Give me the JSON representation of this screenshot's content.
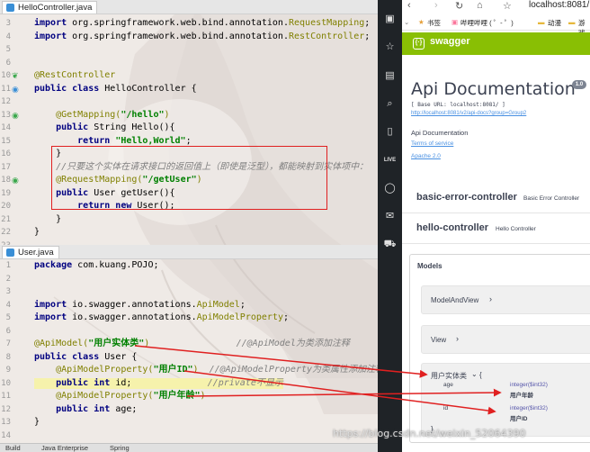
{
  "ide": {
    "tab1": {
      "label": "HelloController.java"
    },
    "tab2": {
      "label": "User.java"
    },
    "file1": {
      "lines": [
        {
          "num": "3",
          "tokens": [
            [
              "kw",
              "import "
            ],
            [
              "pl",
              "org.springframework.web.bind.annotation."
            ],
            [
              "an",
              "RequestMapping"
            ],
            [
              "pl",
              ";"
            ]
          ]
        },
        {
          "num": "4",
          "tokens": [
            [
              "kw",
              "import "
            ],
            [
              "pl",
              "org.springframework.web.bind.annotation."
            ],
            [
              "an",
              "RestController"
            ],
            [
              "pl",
              ";"
            ]
          ]
        },
        {
          "num": "5",
          "tokens": []
        },
        {
          "num": "6",
          "tokens": []
        },
        {
          "num": "10",
          "tokens": [
            [
              "an",
              "@RestController"
            ]
          ]
        },
        {
          "num": "11",
          "tokens": [
            [
              "kw",
              "public class "
            ],
            [
              "pl",
              "HelloController {"
            ]
          ]
        },
        {
          "num": "12",
          "tokens": []
        },
        {
          "num": "13",
          "tokens": [
            [
              "an",
              "    @GetMapping("
            ],
            [
              "str",
              "\"/hello\""
            ],
            [
              "an",
              ")"
            ]
          ]
        },
        {
          "num": "14",
          "tokens": [
            [
              "kw",
              "    public "
            ],
            [
              "pl",
              "String Hello(){"
            ]
          ]
        },
        {
          "num": "15",
          "tokens": [
            [
              "kw",
              "        return "
            ],
            [
              "str",
              "\"Hello,World\""
            ],
            [
              "pl",
              ";"
            ]
          ]
        },
        {
          "num": "16",
          "tokens": [
            [
              "pl",
              "    }"
            ]
          ]
        },
        {
          "num": "17",
          "tokens": [
            [
              "cmt",
              "    //只要这个实体在请求接口的返回值上（即使是泛型），都能映射到实体项中："
            ]
          ]
        },
        {
          "num": "18",
          "tokens": [
            [
              "an",
              "    @RequestMapping("
            ],
            [
              "str",
              "\"/getUser\""
            ],
            [
              "an",
              ")"
            ]
          ]
        },
        {
          "num": "19",
          "tokens": [
            [
              "kw",
              "    public "
            ],
            [
              "pl",
              "User getUser(){"
            ]
          ]
        },
        {
          "num": "20",
          "tokens": [
            [
              "kw",
              "        return new "
            ],
            [
              "pl",
              "User();"
            ]
          ]
        },
        {
          "num": "21",
          "tokens": [
            [
              "pl",
              "    }"
            ]
          ]
        },
        {
          "num": "22",
          "tokens": [
            [
              "pl",
              "}"
            ]
          ]
        },
        {
          "num": "23",
          "tokens": []
        }
      ]
    },
    "file2": {
      "lines": [
        {
          "num": "1",
          "tokens": [
            [
              "kw",
              "package "
            ],
            [
              "pl",
              "com.kuang.POJO;"
            ]
          ]
        },
        {
          "num": "2",
          "tokens": []
        },
        {
          "num": "3",
          "tokens": []
        },
        {
          "num": "4",
          "tokens": [
            [
              "kw",
              "import "
            ],
            [
              "pl",
              "io.swagger.annotations."
            ],
            [
              "an",
              "ApiModel"
            ],
            [
              "pl",
              ";"
            ]
          ]
        },
        {
          "num": "5",
          "tokens": [
            [
              "kw",
              "import "
            ],
            [
              "pl",
              "io.swagger.annotations."
            ],
            [
              "an",
              "ApiModelProperty"
            ],
            [
              "pl",
              ";"
            ]
          ]
        },
        {
          "num": "6",
          "tokens": []
        },
        {
          "num": "7",
          "tokens": [
            [
              "an",
              "@ApiModel("
            ],
            [
              "str",
              "\"用户实体类\""
            ],
            [
              "an",
              ")"
            ],
            [
              "cmt",
              "                //@ApiModel为类添加注释"
            ]
          ]
        },
        {
          "num": "8",
          "tokens": [
            [
              "kw",
              "public class "
            ],
            [
              "pl",
              "User {"
            ]
          ]
        },
        {
          "num": "9",
          "tokens": [
            [
              "an",
              "    @ApiModelProperty("
            ],
            [
              "str",
              "\"用户ID\""
            ],
            [
              "an",
              ")"
            ],
            [
              "cmt",
              "  //@ApiModelProperty为类属性添加注释"
            ]
          ]
        },
        {
          "num": "10",
          "tokens": [
            [
              "kw",
              "    public int "
            ],
            [
              "pl",
              "id;"
            ],
            [
              "cmt",
              "              //private不显示"
            ]
          ]
        },
        {
          "num": "11",
          "tokens": [
            [
              "an",
              "    @ApiModelProperty("
            ],
            [
              "str",
              "\"用户年龄\""
            ],
            [
              "an",
              ")"
            ]
          ]
        },
        {
          "num": "12",
          "tokens": [
            [
              "kw",
              "    public int "
            ],
            [
              "pl",
              "age;"
            ]
          ]
        },
        {
          "num": "13",
          "tokens": [
            [
              "pl",
              "}"
            ]
          ]
        },
        {
          "num": "14",
          "tokens": []
        }
      ]
    },
    "bottom": {
      "build": "Build",
      "java": "Java Enterprise",
      "spring": "Spring"
    }
  },
  "dock": {
    "icons": [
      "window-icon",
      "star-icon",
      "book-icon",
      "search-icon",
      "phone-icon",
      "live-icon",
      "chat-icon",
      "mail-icon",
      "cart-icon"
    ]
  },
  "browser": {
    "url": "localhost:8081/",
    "bookmarks": {
      "b1": "书签",
      "b2": "哔哩哔哩 ( ゜- ゜)",
      "b3": "动漫",
      "b4": "游戏"
    },
    "brand": "swagger",
    "api_title": "Api Documentation",
    "version": "1.0",
    "base_url": "[ Base URL: localhost:8081/ ]",
    "docs_link": "http://localhost:8081/v2/api-docs?group=Group2",
    "desc": "Api Documentation",
    "terms": "Terms of service",
    "license": "Apache 2.0",
    "controllers": [
      {
        "name": "basic-error-controller",
        "desc": "Basic Error Controller"
      },
      {
        "name": "hello-controller",
        "desc": "Hello Controller"
      }
    ],
    "models_title": "Models",
    "models": {
      "m1": "ModelAndView",
      "m2": "View",
      "m3": "用户实体类",
      "m3_brace": "{",
      "age": "age",
      "age_type": "integer($int32)",
      "age_desc": "用户年龄",
      "id": "id",
      "id_type": "integer($int32)",
      "id_desc": "用户ID",
      "close_brace": "}"
    }
  },
  "watermark": "https://blog.csdn.net/weixin_52064390",
  "colors": {
    "swagger_green": "#89bf04",
    "annotation_box": "#e02020",
    "arrow": "#e02020"
  }
}
